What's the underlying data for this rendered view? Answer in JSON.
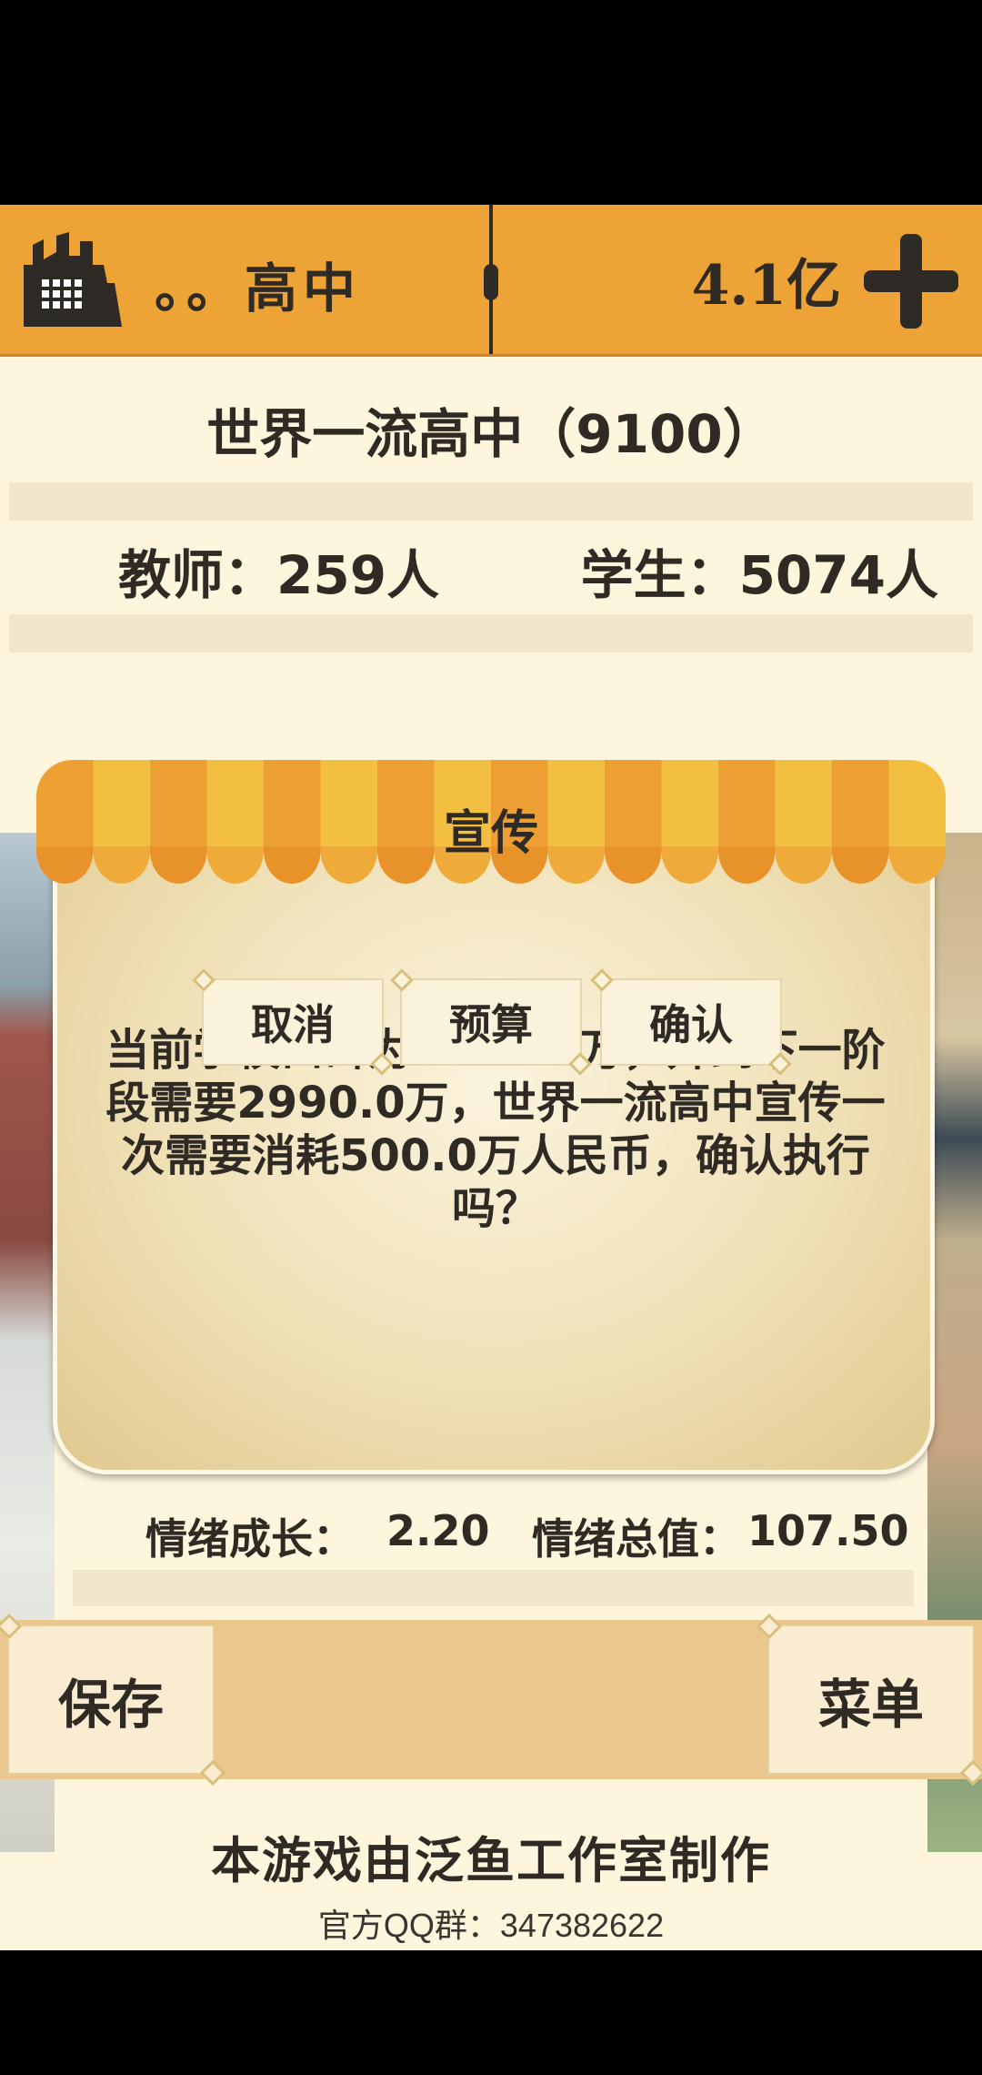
{
  "topbar": {
    "school_name": "。。高中",
    "money": "4.1亿"
  },
  "info": {
    "rank": "世界一流高中（9100）",
    "teachers": "教师：259人",
    "students": "学生：5074人"
  },
  "dialog": {
    "title": "宣传",
    "message": "当前学校口碑为4010.0万，升到下一阶段需要2990.0万，世界一流高中宣传一次需要消耗500.0万人民币，确认执行吗？",
    "cancel": "取消",
    "budget": "预算",
    "confirm": "确认"
  },
  "emotion": {
    "growth_label": "情绪成长：",
    "growth_value": "2.20",
    "total_label": "情绪总值：",
    "total_value": "107.50"
  },
  "bottom": {
    "save": "保存",
    "menu": "菜单",
    "credits": "本游戏由泛鱼工作室制作",
    "qq_group": "官方QQ群：347382622"
  },
  "colors": {
    "topbar": "#eea336",
    "accent_dark": "#2e2a26",
    "awning_orange": "#ee9f34",
    "awning_yellow": "#f2bf40"
  }
}
